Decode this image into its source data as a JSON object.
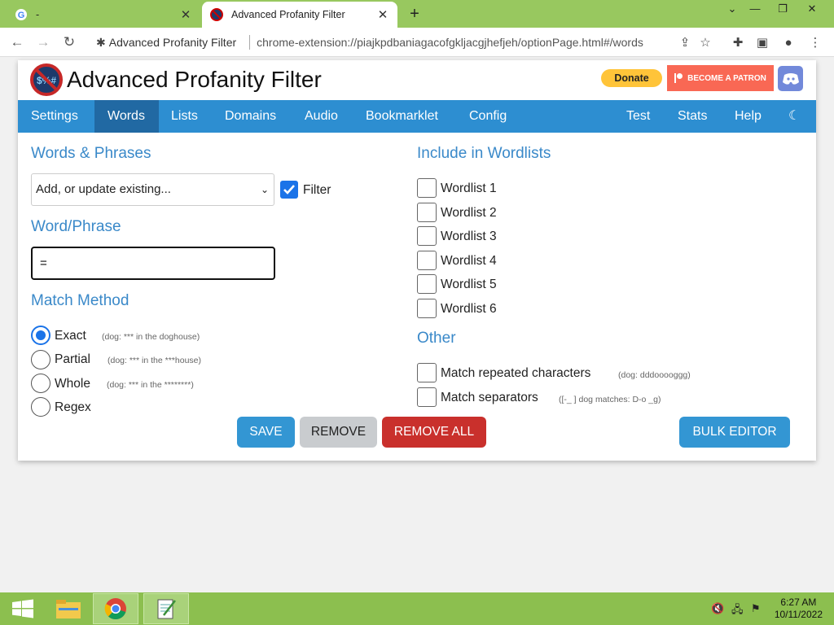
{
  "browser": {
    "tabs": [
      {
        "label": "-",
        "icon": "google-icon"
      },
      {
        "label": "Advanced Profanity Filter",
        "icon": "apf-icon"
      }
    ],
    "new_tab": "+",
    "address": {
      "site_label": "Advanced Profanity Filter",
      "url": "chrome-extension://piajkpdbaniagacofgkljacgjhefjeh/optionPage.html#/words"
    }
  },
  "app": {
    "title": "Advanced Profanity Filter",
    "donate_label": "Donate",
    "patron_label": "BECOME A PATRON"
  },
  "nav": {
    "items": [
      "Settings",
      "Words",
      "Lists",
      "Domains",
      "Audio",
      "Bookmarklet",
      "Config"
    ],
    "right_items": [
      "Test",
      "Stats",
      "Help"
    ],
    "active": "Words"
  },
  "words": {
    "section_title": "Words & Phrases",
    "select_value": "Add, or update existing...",
    "filter_label": "Filter",
    "filter_checked": true,
    "word_title": "Word/Phrase",
    "word_value": "=",
    "match_title": "Match Method",
    "methods": [
      {
        "label": "Exact",
        "hint": "(dog: *** in the doghouse)",
        "checked": true
      },
      {
        "label": "Partial",
        "hint": "(dog: *** in the ***house)",
        "checked": false
      },
      {
        "label": "Whole",
        "hint": "(dog: *** in the ********)",
        "checked": false
      },
      {
        "label": "Regex",
        "hint": "",
        "checked": false
      }
    ]
  },
  "wordlists": {
    "title": "Include in Wordlists",
    "items": [
      "Wordlist 1",
      "Wordlist 2",
      "Wordlist 3",
      "Wordlist 4",
      "Wordlist 5",
      "Wordlist 6"
    ]
  },
  "other": {
    "title": "Other",
    "items": [
      {
        "label": "Match repeated characters",
        "hint": "(dog: dddooooggg)"
      },
      {
        "label": "Match separators",
        "hint": "([-_ ] dog matches: D-o _g)"
      }
    ]
  },
  "buttons": {
    "save": "SAVE",
    "remove": "REMOVE",
    "remove_all": "REMOVE ALL",
    "bulk_editor": "BULK EDITOR"
  },
  "taskbar": {
    "time": "6:27 AM",
    "date": "10/11/2022"
  },
  "colors": {
    "accent": "#2d8ed1",
    "nav_active": "#2169a3",
    "danger": "#c9302c",
    "title_blue": "#3a89c9"
  }
}
